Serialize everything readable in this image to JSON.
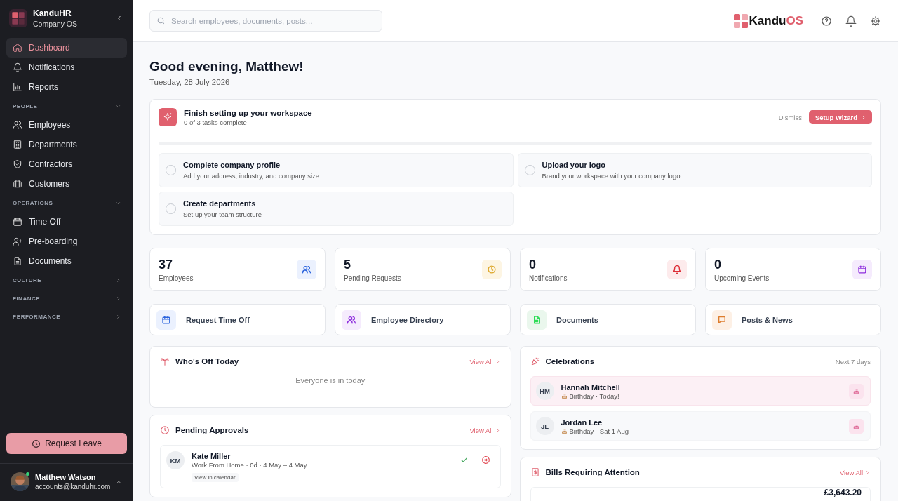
{
  "sidebar": {
    "brand": {
      "name": "KanduHR",
      "subtitle": "Company OS"
    },
    "items": [
      {
        "label": "Dashboard",
        "selected": true
      },
      {
        "label": "Notifications",
        "selected": false
      },
      {
        "label": "Reports",
        "selected": false
      }
    ],
    "sections": [
      {
        "title": "PEOPLE",
        "expanded": true,
        "items": [
          {
            "label": "Employees",
            "selected": false
          },
          {
            "label": "Departments",
            "selected": false
          },
          {
            "label": "Contractors",
            "selected": false
          },
          {
            "label": "Customers",
            "selected": false
          }
        ]
      },
      {
        "title": "OPERATIONS",
        "expanded": true,
        "items": [
          {
            "label": "Time Off",
            "selected": false
          },
          {
            "label": "Pre-boarding",
            "selected": false
          },
          {
            "label": "Documents",
            "selected": false
          }
        ]
      },
      {
        "title": "CULTURE",
        "expanded": false
      },
      {
        "title": "FINANCE",
        "expanded": false
      },
      {
        "title": "PERFORMANCE",
        "expanded": false
      }
    ],
    "request_button": "Request Leave",
    "user": {
      "name": "Matthew Watson",
      "email": "accounts@kanduhr.com",
      "online": true
    }
  },
  "header": {
    "search": {
      "placeholder": "Search employees, documents, posts..."
    },
    "logo": {
      "part_1": "Kandu",
      "part_2": "OS"
    }
  },
  "greeting": {
    "title": "Good evening, Matthew!",
    "date": "Tuesday, 28 July 2026"
  },
  "setup": {
    "title": "Finish setting up your workspace",
    "subtitle": "0 of 3 tasks complete",
    "dismiss": "Dismiss",
    "button": "Setup Wizard",
    "level": 0,
    "tasks": [
      {
        "title": "Complete company profile",
        "description": "Add your address, industry, and company size",
        "checked": false
      },
      {
        "title": "Upload your logo",
        "description": "Brand your workspace with your company logo",
        "checked": false
      },
      {
        "title": "Create departments",
        "description": "Set up your team structure",
        "checked": false
      }
    ]
  },
  "stats": [
    {
      "value": "37",
      "label": "Employees",
      "color": "#ebf1fe"
    },
    {
      "value": "5",
      "label": "Pending Requests",
      "color": "#fdf5e3"
    },
    {
      "value": "0",
      "label": "Notifications",
      "color": "#fdebec"
    },
    {
      "value": "0",
      "label": "Upcoming Events",
      "color": "#f5ebfd"
    }
  ],
  "quick_actions": [
    {
      "label": "Request Time Off",
      "color": "#ebf1fe"
    },
    {
      "label": "Employee Directory",
      "color": "#f5ebfd"
    },
    {
      "label": "Documents",
      "color": "#eaf7ed"
    },
    {
      "label": "Posts & News",
      "color": "#fdf0e5"
    }
  ],
  "whos_off": {
    "title": "Who's Off Today",
    "link": "View All",
    "empty": "Everyone is in today"
  },
  "approvals": {
    "title": "Pending Approvals",
    "link": "View All",
    "items": [
      {
        "initials": "KM",
        "name": "Kate Miller",
        "details": "Work From Home · 0d · 4 May – 4 May",
        "calendar_link": "View in calendar"
      }
    ]
  },
  "celebrations": {
    "title": "Celebrations",
    "range": "Next 7 days",
    "items": [
      {
        "initials": "HM",
        "name": "Hannah Mitchell",
        "details": "Birthday · Today!",
        "today": true
      },
      {
        "initials": "JL",
        "name": "Jordan Lee",
        "details": "Birthday · Sat 1 Aug",
        "today": false
      }
    ]
  },
  "bills": {
    "title": "Bills Requiring Attention",
    "link": "View All",
    "items": [
      {
        "amount": "£3,643.20"
      }
    ]
  }
}
